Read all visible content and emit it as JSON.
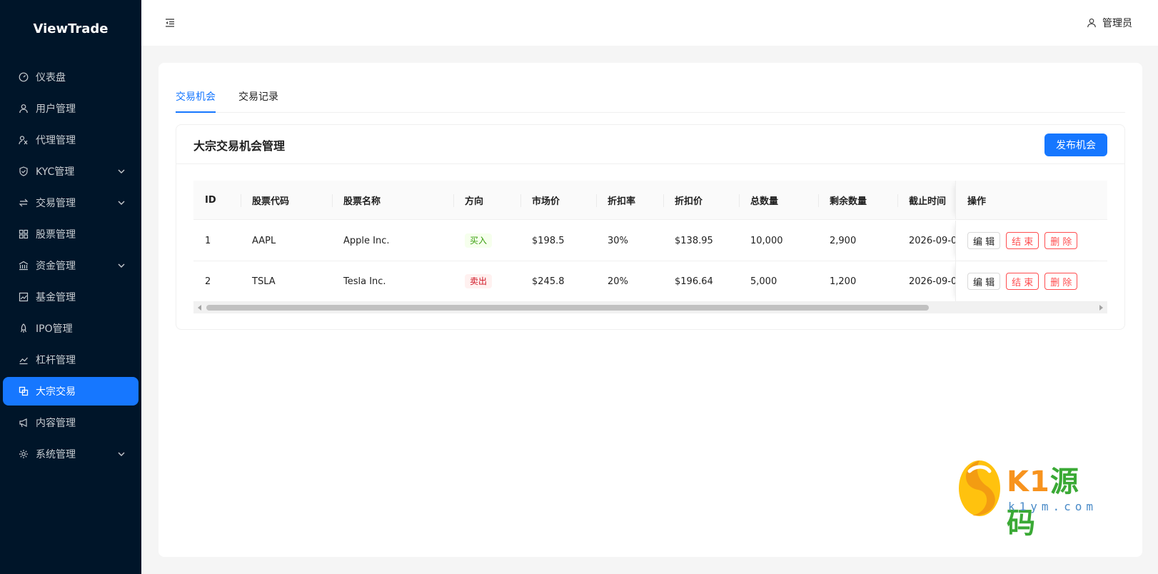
{
  "app": {
    "logo": "ViewTrade"
  },
  "sidebar": {
    "items": [
      {
        "label": "仪表盘",
        "icon": "dashboard-icon",
        "has_children": false
      },
      {
        "label": "用户管理",
        "icon": "user-icon",
        "has_children": false
      },
      {
        "label": "代理管理",
        "icon": "agent-icon",
        "has_children": false
      },
      {
        "label": "KYC管理",
        "icon": "shield-icon",
        "has_children": true
      },
      {
        "label": "交易管理",
        "icon": "swap-icon",
        "has_children": true
      },
      {
        "label": "股票管理",
        "icon": "grid-icon",
        "has_children": false
      },
      {
        "label": "资金管理",
        "icon": "bank-icon",
        "has_children": true
      },
      {
        "label": "基金管理",
        "icon": "fund-chart-icon",
        "has_children": false
      },
      {
        "label": "IPO管理",
        "icon": "rocket-icon",
        "has_children": false
      },
      {
        "label": "杠杆管理",
        "icon": "line-chart-icon",
        "has_children": false
      },
      {
        "label": "大宗交易",
        "icon": "block-trade-icon",
        "has_children": false,
        "active": true
      },
      {
        "label": "内容管理",
        "icon": "megaphone-icon",
        "has_children": false
      },
      {
        "label": "系统管理",
        "icon": "settings-icon",
        "has_children": true
      }
    ]
  },
  "header": {
    "user_label": "管理员"
  },
  "tabs": [
    {
      "label": "交易机会",
      "active": true
    },
    {
      "label": "交易记录",
      "active": false
    }
  ],
  "panel": {
    "title": "大宗交易机会管理",
    "publish_button": "发布机会"
  },
  "table": {
    "columns": [
      "ID",
      "股票代码",
      "股票名称",
      "方向",
      "市场价",
      "折扣率",
      "折扣价",
      "总数量",
      "剩余数量",
      "截止时间",
      "操作"
    ],
    "rows": [
      {
        "id": "1",
        "code": "AAPL",
        "name": "Apple Inc.",
        "direction": "买入",
        "direction_type": "buy",
        "market_price": "$198.5",
        "discount_rate": "30%",
        "discount_price": "$138.95",
        "total": "10,000",
        "remaining": "2,900",
        "deadline": "2026-09-0"
      },
      {
        "id": "2",
        "code": "TSLA",
        "name": "Tesla Inc.",
        "direction": "卖出",
        "direction_type": "sell",
        "market_price": "$245.8",
        "discount_rate": "20%",
        "discount_price": "$196.64",
        "total": "5,000",
        "remaining": "1,200",
        "deadline": "2026-09-0"
      }
    ],
    "actions": {
      "edit": "编 辑",
      "end": "结 束",
      "delete": "删 除"
    }
  },
  "watermark": {
    "brand_latin": "K1",
    "brand_cn": "源码",
    "domain": "k1ym.com"
  },
  "colors": {
    "sidebar_bg": "#001529",
    "accent": "#1677ff",
    "buy": "#389e0d",
    "sell": "#cf1322",
    "danger": "#ff4d4f"
  }
}
